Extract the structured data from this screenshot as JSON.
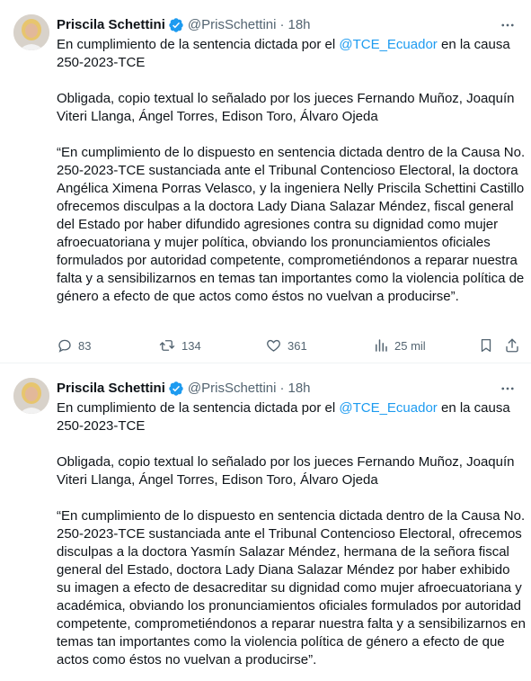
{
  "tweets": [
    {
      "author_name": "Priscila Schettini",
      "handle": "@PrisSchettini",
      "separator": "·",
      "time": "18h",
      "text": {
        "line1_before": "En cumplimiento de la sentencia dictada por el ",
        "mention": "@TCE_Ecuador",
        "line1_after": " en la causa 250-2023-TCE",
        "paragraph2": "Obligada, copio textual lo señalado por los jueces Fernando Muñoz, Joaquín Viteri Llanga, Ángel Torres, Edison Toro, Álvaro Ojeda",
        "paragraph3": "“En cumplimiento de lo dispuesto en sentencia dictada dentro de la Causa No. 250-2023-TCE sustanciada ante el Tribunal Contencioso Electoral, la doctora Angélica Ximena Porras Velasco, y la ingeniera Nelly Priscila Schettini Castillo ofrecemos disculpas a la doctora Lady Diana Salazar Méndez, fiscal general del Estado por haber difundido agresiones contra su dignidad como mujer afroecuatoriana y mujer política, obviando los pronunciamientos oficiales formulados por autoridad competente, comprometiéndonos a reparar nuestra falta y a sensibilizarnos en temas tan importantes como la violencia política de género a efecto de que actos como éstos no vuelvan a producirse”."
      },
      "replies": "83",
      "retweets": "134",
      "likes": "361",
      "views": "25 mil"
    },
    {
      "author_name": "Priscila Schettini",
      "handle": "@PrisSchettini",
      "separator": "·",
      "time": "18h",
      "text": {
        "line1_before": "En cumplimiento de la sentencia dictada por el ",
        "mention": "@TCE_Ecuador",
        "line1_after": " en la causa 250-2023-TCE",
        "paragraph2": "Obligada, copio textual lo señalado por los jueces Fernando Muñoz, Joaquín Viteri Llanga, Ángel Torres, Edison Toro, Álvaro Ojeda",
        "paragraph3": "“En cumplimiento de lo dispuesto en sentencia dictada dentro de la Causa No. 250-2023-TCE sustanciada ante el Tribunal Contencioso Electoral, ofrecemos disculpas a la doctora Yasmín Salazar Méndez, hermana de la señora fiscal general del Estado, doctora Lady Diana Salazar Méndez por haber  exhibido su imagen a efecto de desacreditar  su dignidad como mujer afroecuatoriana y académica, obviando los pronunciamientos oficiales formulados por autoridad competente, comprometiéndonos a reparar nuestra falta y a sensibilizarnos en temas tan importantes como la violencia política de género a efecto de que actos como éstos no vuelvan a producirse”."
      }
    }
  ],
  "icons": {
    "verified": "verified-badge-icon",
    "more": "more-options-icon",
    "reply": "reply-icon",
    "retweet": "retweet-icon",
    "like": "heart-icon",
    "views": "views-chart-icon",
    "bookmark": "bookmark-icon",
    "share": "share-icon"
  },
  "colors": {
    "text": "#0f1419",
    "secondary": "#536471",
    "accent": "#1d9bf0",
    "divider": "#eff3f4"
  }
}
